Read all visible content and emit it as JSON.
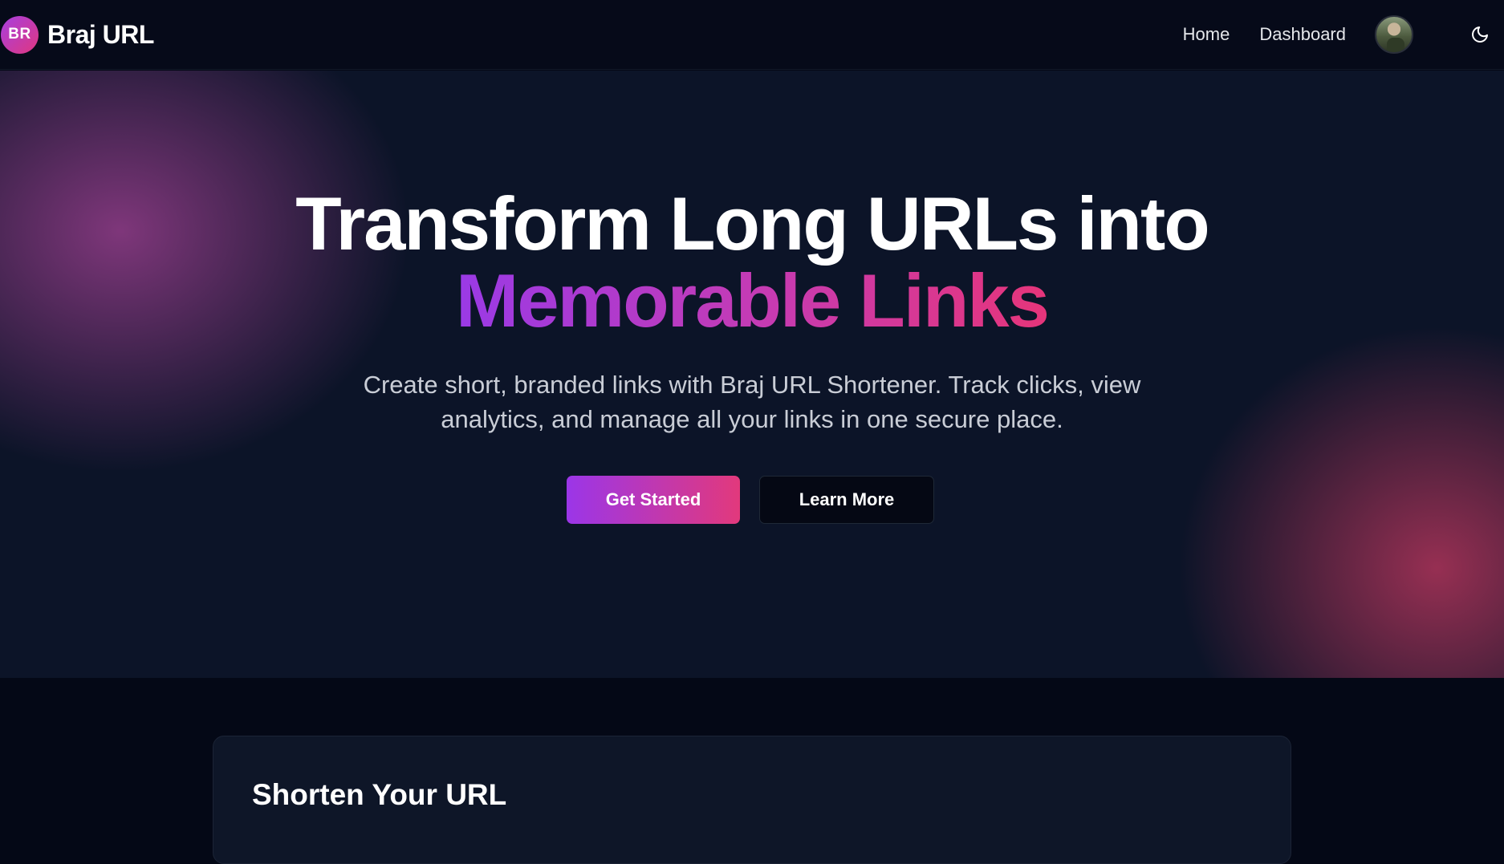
{
  "brand": {
    "logo_text": "BR",
    "name": "Braj URL"
  },
  "nav": {
    "home": "Home",
    "dashboard": "Dashboard"
  },
  "hero": {
    "title_line1": "Transform Long URLs into",
    "title_line2": "Memorable Links",
    "subtitle": "Create short, branded links with Braj URL Shortener. Track clicks, view analytics, and manage all your links in one secure place.",
    "primary_button": "Get Started",
    "secondary_button": "Learn More"
  },
  "shorten_card": {
    "title": "Shorten Your URL"
  },
  "icons": {
    "theme_toggle": "moon-icon",
    "avatar": "user-avatar"
  },
  "colors": {
    "accent_start": "#9b36e8",
    "accent_end": "#e2397c",
    "background": "#040816",
    "hero_background": "#0c1428"
  }
}
